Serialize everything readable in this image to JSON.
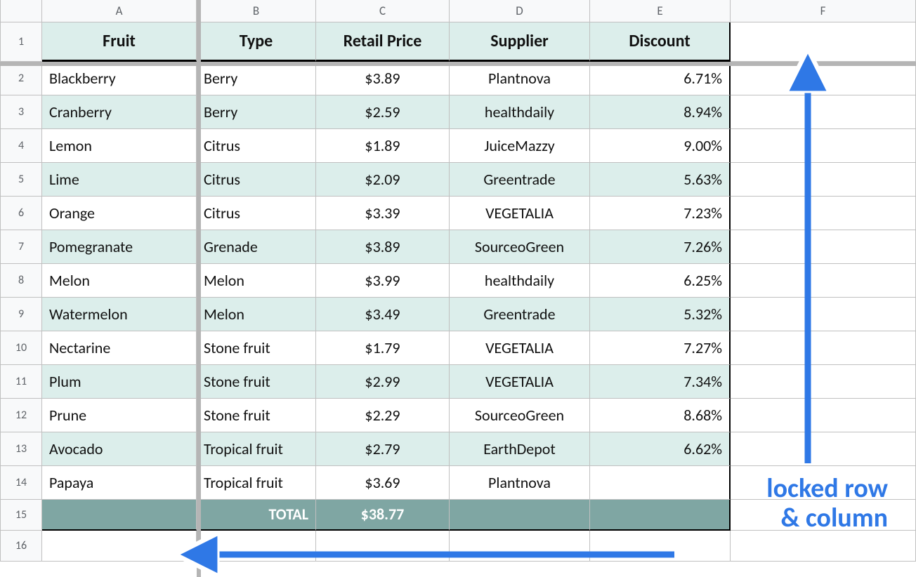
{
  "columns": [
    "A",
    "B",
    "C",
    "D",
    "E",
    "F"
  ],
  "header_row_number": "1",
  "headers": {
    "A": "Fruit",
    "B": "Type",
    "C": "Retail Price",
    "D": "Supplier",
    "E": "Discount"
  },
  "rows": [
    {
      "n": "2",
      "A": "Blackberry",
      "B": "Berry",
      "C": "$3.89",
      "D": "Plantnova",
      "E": "6.71%"
    },
    {
      "n": "3",
      "A": "Cranberry",
      "B": "Berry",
      "C": "$2.59",
      "D": "healthdaily",
      "E": "8.94%"
    },
    {
      "n": "4",
      "A": "Lemon",
      "B": "Citrus",
      "C": "$1.89",
      "D": "JuiceMazzy",
      "E": "9.00%"
    },
    {
      "n": "5",
      "A": "Lime",
      "B": "Citrus",
      "C": "$2.09",
      "D": "Greentrade",
      "E": "5.63%"
    },
    {
      "n": "6",
      "A": "Orange",
      "B": "Citrus",
      "C": "$3.39",
      "D": "VEGETALIA",
      "E": "7.23%"
    },
    {
      "n": "7",
      "A": "Pomegranate",
      "B": "Grenade",
      "C": "$3.89",
      "D": "SourceoGreen",
      "E": "7.26%"
    },
    {
      "n": "8",
      "A": "Melon",
      "B": "Melon",
      "C": "$3.99",
      "D": "healthdaily",
      "E": "6.25%"
    },
    {
      "n": "9",
      "A": "Watermelon",
      "B": "Melon",
      "C": "$3.49",
      "D": "Greentrade",
      "E": "5.32%"
    },
    {
      "n": "10",
      "A": "Nectarine",
      "B": "Stone fruit",
      "C": "$1.79",
      "D": "VEGETALIA",
      "E": "7.27%"
    },
    {
      "n": "11",
      "A": "Plum",
      "B": "Stone fruit",
      "C": "$2.99",
      "D": "VEGETALIA",
      "E": "7.34%"
    },
    {
      "n": "12",
      "A": "Prune",
      "B": "Stone fruit",
      "C": "$2.29",
      "D": "SourceoGreen",
      "E": "8.68%"
    },
    {
      "n": "13",
      "A": "Avocado",
      "B": "Tropical fruit",
      "C": "$2.79",
      "D": "EarthDepot",
      "E": "6.62%"
    },
    {
      "n": "14",
      "A": "Papaya",
      "B": "Tropical fruit",
      "C": "$3.69",
      "D": "Plantnova",
      "E": ""
    }
  ],
  "total": {
    "n": "15",
    "label": "TOTAL",
    "value": "$38.77"
  },
  "empty_row_n": "16",
  "annotation": {
    "line1": "locked row",
    "line2": "& column"
  },
  "chart_data": {
    "type": "table",
    "columns": [
      "Fruit",
      "Type",
      "Retail Price",
      "Supplier",
      "Discount"
    ],
    "rows": [
      [
        "Blackberry",
        "Berry",
        "$3.89",
        "Plantnova",
        "6.71%"
      ],
      [
        "Cranberry",
        "Berry",
        "$2.59",
        "healthdaily",
        "8.94%"
      ],
      [
        "Lemon",
        "Citrus",
        "$1.89",
        "JuiceMazzy",
        "9.00%"
      ],
      [
        "Lime",
        "Citrus",
        "$2.09",
        "Greentrade",
        "5.63%"
      ],
      [
        "Orange",
        "Citrus",
        "$3.39",
        "VEGETALIA",
        "7.23%"
      ],
      [
        "Pomegranate",
        "Grenade",
        "$3.89",
        "SourceoGreen",
        "7.26%"
      ],
      [
        "Melon",
        "Melon",
        "$3.99",
        "healthdaily",
        "6.25%"
      ],
      [
        "Watermelon",
        "Melon",
        "$3.49",
        "Greentrade",
        "5.32%"
      ],
      [
        "Nectarine",
        "Stone fruit",
        "$1.79",
        "VEGETALIA",
        "7.27%"
      ],
      [
        "Plum",
        "Stone fruit",
        "$2.99",
        "VEGETALIA",
        "7.34%"
      ],
      [
        "Prune",
        "Stone fruit",
        "$2.29",
        "SourceoGreen",
        "8.68%"
      ],
      [
        "Avocado",
        "Tropical fruit",
        "$2.79",
        "EarthDepot",
        "6.62%"
      ],
      [
        "Papaya",
        "Tropical fruit",
        "$3.69",
        "Plantnova",
        ""
      ]
    ],
    "total_row": [
      "",
      "TOTAL",
      "$38.77",
      "",
      ""
    ]
  }
}
